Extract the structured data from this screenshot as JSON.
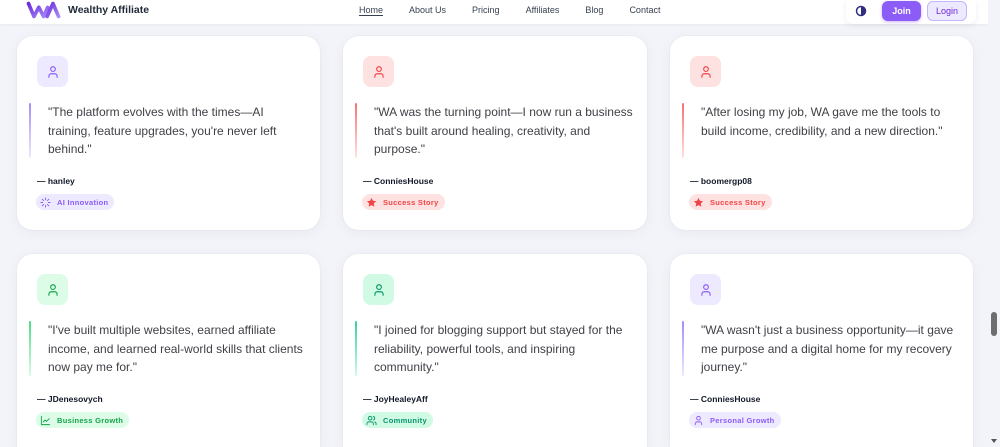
{
  "brand": {
    "name": "Wealthy Affiliate",
    "logo_icon": "wa-logo"
  },
  "nav": {
    "items": [
      {
        "label": "Home",
        "active": true
      },
      {
        "label": "About Us",
        "active": false
      },
      {
        "label": "Pricing",
        "active": false
      },
      {
        "label": "Affiliates",
        "active": false
      },
      {
        "label": "Blog",
        "active": false
      },
      {
        "label": "Contact",
        "active": false
      }
    ]
  },
  "actions": {
    "theme_toggle_icon": "contrast-icon",
    "join_label": "Join",
    "login_label": "Login"
  },
  "colors": {
    "brand": "#8b5cf6",
    "brand_soft": "#ede9fe",
    "page_bg": "#f3f4f9",
    "card_bg": "#ffffff",
    "quote_text": "#3f3f46",
    "author_text": "#111827"
  },
  "testimonials": [
    {
      "avatar_icon": "user-icon",
      "quote": "\"The platform evolves with the times—AI\ntraining, feature upgrades, you're never left\nbehind.\"",
      "author": "— hanley",
      "badge": "AI Innovation",
      "badge_icon": "sparkle-icon",
      "accent": "#a78bfa",
      "soft": "#ede9fe",
      "ink": "#8b5cf6"
    },
    {
      "avatar_icon": "user-icon",
      "quote": "\"WA was the turning point—I now run a business\nthat's built around healing, creativity, and\npurpose.\"",
      "author": "— ConniesHouse",
      "badge": "Success Story",
      "badge_icon": "star-icon",
      "accent": "#f87171",
      "soft": "#fee2e2",
      "ink": "#ef4444"
    },
    {
      "avatar_icon": "user-icon",
      "quote": "\"After losing my job, WA gave me the tools to\nbuild income, credibility, and a new direction.\"",
      "author": "— boomergp08",
      "badge": "Success Story",
      "badge_icon": "star-icon",
      "accent": "#f87171",
      "soft": "#fee2e2",
      "ink": "#ef4444"
    },
    {
      "avatar_icon": "user-icon",
      "quote": "\"I've built multiple websites, earned affiliate\nincome, and learned real-world skills that clients\nnow pay me for.\"",
      "author": "— JDenesovych",
      "badge": "Business Growth",
      "badge_icon": "chart-line-icon",
      "accent": "#4ade80",
      "soft": "#dcfce7",
      "ink": "#16a34a"
    },
    {
      "avatar_icon": "user-icon",
      "quote": "\"I joined for blogging support but stayed for the\nreliability, powerful tools, and inspiring\ncommunity.\"",
      "author": "— JoyHealeyAff",
      "badge": "Community",
      "badge_icon": "users-icon",
      "accent": "#34d399",
      "soft": "#d1fae5",
      "ink": "#059669"
    },
    {
      "avatar_icon": "user-icon",
      "quote": "\"WA wasn't just a business opportunity—it gave\nme purpose and a digital home for my recovery\njourney.\"",
      "author": "— ConniesHouse",
      "badge": "Personal Growth",
      "badge_icon": "user-icon",
      "accent": "#a78bfa",
      "soft": "#ede9fe",
      "ink": "#8b5cf6"
    }
  ]
}
